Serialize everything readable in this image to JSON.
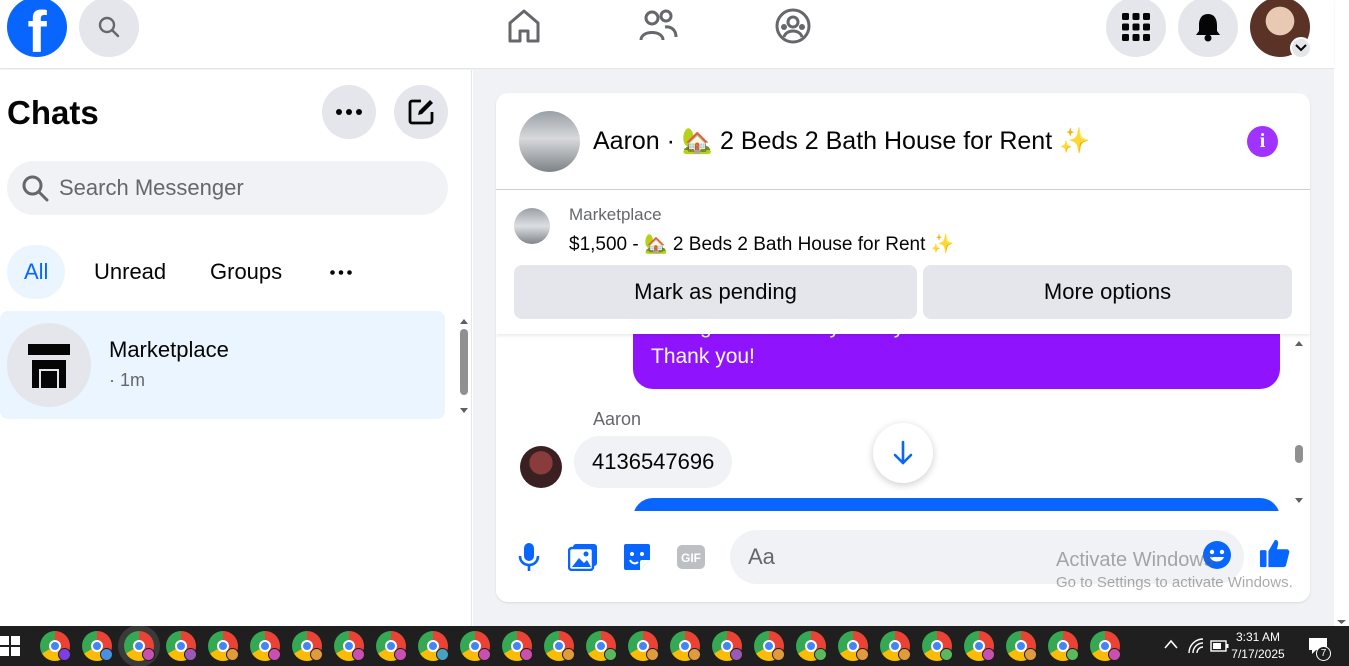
{
  "topbar": {
    "logo_letter": "f",
    "icons": [
      "search-icon",
      "home-icon",
      "friends-icon",
      "groups-icon",
      "menu-grid-icon",
      "bell-icon",
      "avatar",
      "chevron-down-icon"
    ]
  },
  "chats": {
    "title": "Chats",
    "search_placeholder": "Search Messenger",
    "tabs": [
      {
        "label": "All",
        "active": true
      },
      {
        "label": "Unread",
        "active": false
      },
      {
        "label": "Groups",
        "active": false
      }
    ],
    "items": [
      {
        "name": "Marketplace",
        "time": "· 1m"
      }
    ]
  },
  "conversation": {
    "title": "Aaron · 🏡 2 Beds 2 Bath House for Rent ✨",
    "marketplace": {
      "label": "Marketplace",
      "listing": "$1,500 - 🏡 2 Beds 2 Bath House for Rent ✨",
      "mark_pending_label": "Mark as pending",
      "more_options_label": "More options"
    },
    "messages": {
      "outgoing_partial_line": "arrange a visit today or at your earliest convenience. .",
      "outgoing_last_line": "Thank you!",
      "sender_name": "Aaron",
      "incoming_text": "4136547696"
    },
    "composer_placeholder": "Aa"
  },
  "watermark": {
    "line1": "Activate Windows",
    "line2": "Go to Settings to activate Windows."
  },
  "taskbar": {
    "time": "3:31 AM",
    "date": "7/17/2025",
    "notification_count": "7"
  },
  "colors": {
    "fb_blue": "#0866ff",
    "purple_bubble": "#9013fe",
    "info_purple": "#a033ff",
    "grey_surface": "#e4e6eb",
    "taskbar": "#1f1f1f"
  }
}
